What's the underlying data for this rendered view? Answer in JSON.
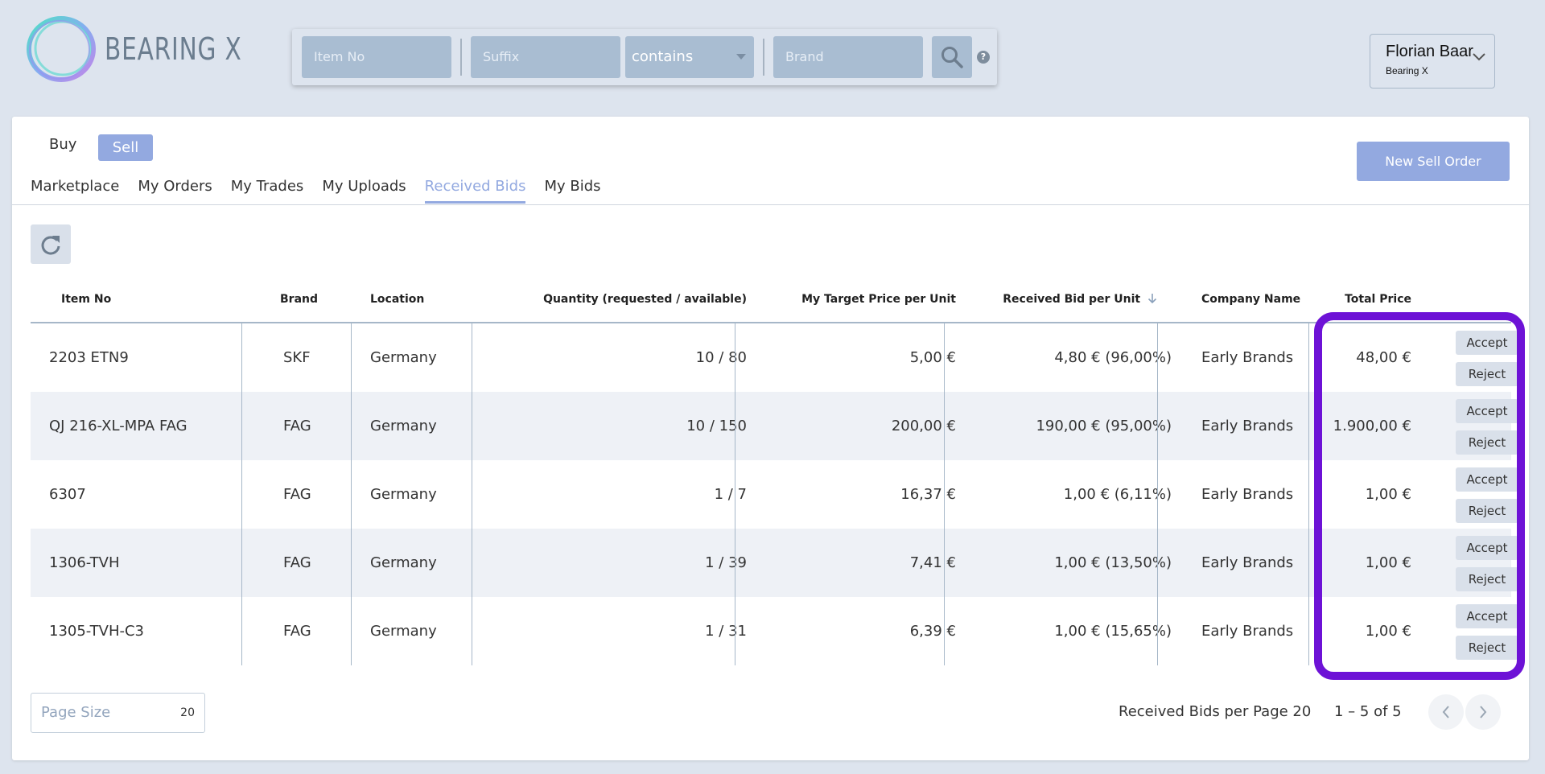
{
  "brand": {
    "name": "BEARING X"
  },
  "search": {
    "item_no_placeholder": "Item No",
    "suffix_placeholder": "Suffix",
    "match_mode": "contains",
    "brand_placeholder": "Brand",
    "help": "?"
  },
  "user": {
    "name": "Florian Baar",
    "company": "Bearing X"
  },
  "mode": {
    "buy": "Buy",
    "sell": "Sell"
  },
  "tabs": [
    {
      "label": "Marketplace"
    },
    {
      "label": "My Orders"
    },
    {
      "label": "My Trades"
    },
    {
      "label": "My Uploads"
    },
    {
      "label": "Received Bids"
    },
    {
      "label": "My Bids"
    }
  ],
  "new_sell_order": "New Sell Order",
  "table": {
    "headers": {
      "item_no": "Item No",
      "brand": "Brand",
      "location": "Location",
      "quantity": "Quantity (requested / available)",
      "target_price": "My Target Price per Unit",
      "received_bid": "Received Bid per Unit",
      "company": "Company Name",
      "total": "Total Price"
    },
    "rows": [
      {
        "item_no": "2203 ETN9",
        "brand": "SKF",
        "location": "Germany",
        "quantity": "10 / 80",
        "target_price": "5,00 €",
        "received_bid": "4,80 € (96,00%)",
        "company": "Early Brands",
        "total": "48,00 €"
      },
      {
        "item_no": "QJ 216-XL-MPA FAG",
        "brand": "FAG",
        "location": "Germany",
        "quantity": "10 / 150",
        "target_price": "200,00 €",
        "received_bid": "190,00 € (95,00%)",
        "company": "Early Brands",
        "total": "1.900,00 €"
      },
      {
        "item_no": "6307",
        "brand": "FAG",
        "location": "Germany",
        "quantity": "1 / 7",
        "target_price": "16,37 €",
        "received_bid": "1,00 € (6,11%)",
        "company": "Early Brands",
        "total": "1,00 €"
      },
      {
        "item_no": "1306-TVH",
        "brand": "FAG",
        "location": "Germany",
        "quantity": "1 / 39",
        "target_price": "7,41 €",
        "received_bid": "1,00 € (13,50%)",
        "company": "Early Brands",
        "total": "1,00 €"
      },
      {
        "item_no": "1305-TVH-C3",
        "brand": "FAG",
        "location": "Germany",
        "quantity": "1 / 31",
        "target_price": "6,39 €",
        "received_bid": "1,00 € (15,65%)",
        "company": "Early Brands",
        "total": "1,00 €"
      }
    ],
    "accept_label": "Accept",
    "reject_label": "Reject"
  },
  "pagination": {
    "page_size_label": "Page Size",
    "page_size_value": "20",
    "per_page_label": "Received Bids per Page 20",
    "range": "1 – 5 of 5"
  },
  "colors": {
    "accent": "#93a9e0",
    "highlight": "#6d12d6"
  }
}
